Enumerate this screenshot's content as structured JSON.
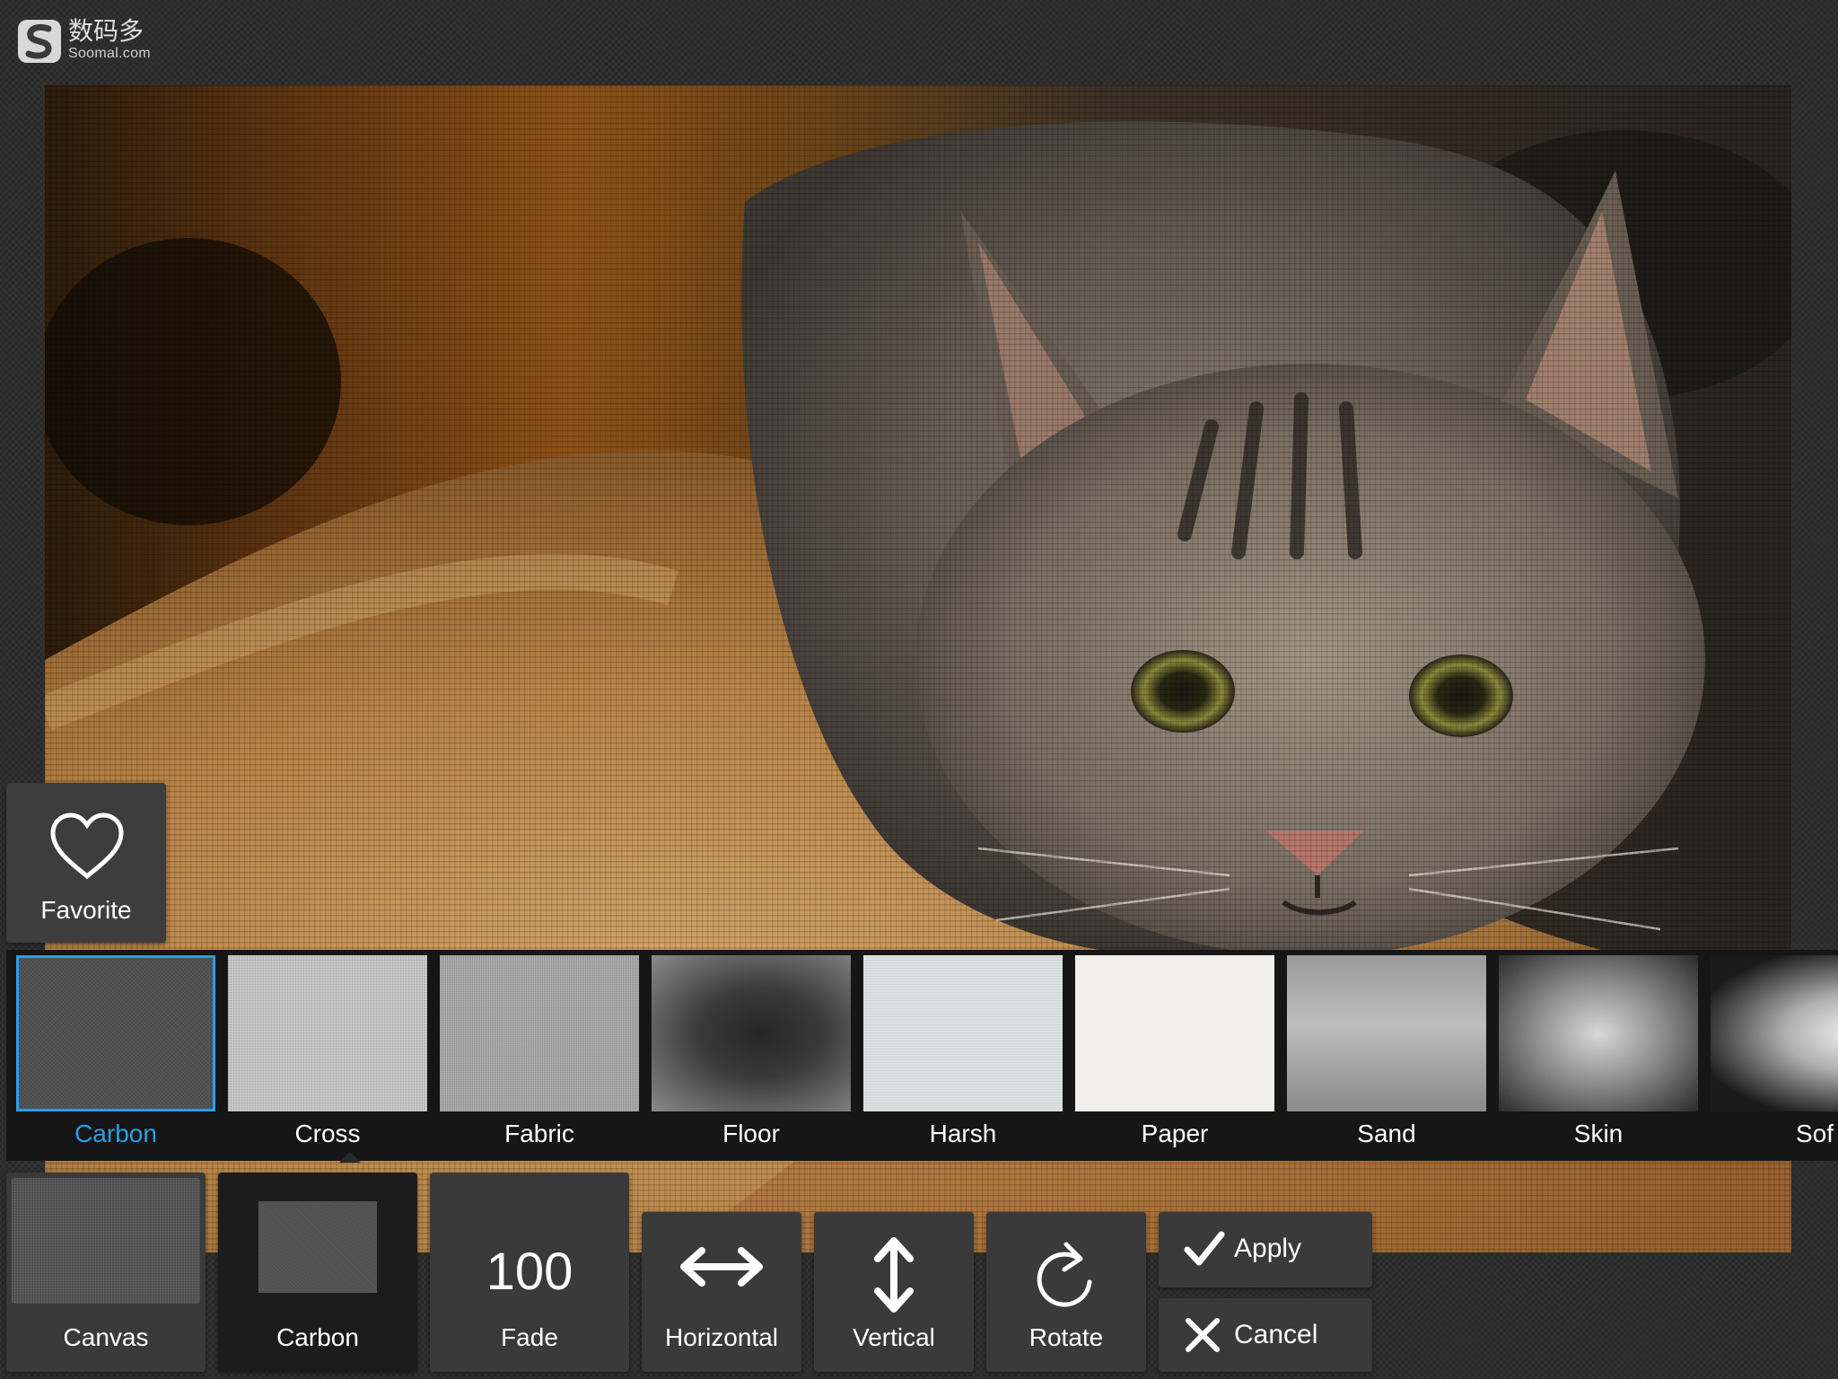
{
  "watermark": {
    "cn": "数码多",
    "en": "Soomal.com"
  },
  "favorite": {
    "label": "Favorite",
    "icon": "heart-icon"
  },
  "textures": [
    {
      "label": "Carbon",
      "selected": true
    },
    {
      "label": "Cross",
      "selected": false
    },
    {
      "label": "Fabric",
      "selected": false
    },
    {
      "label": "Floor",
      "selected": false
    },
    {
      "label": "Harsh",
      "selected": false
    },
    {
      "label": "Paper",
      "selected": false
    },
    {
      "label": "Sand",
      "selected": false
    },
    {
      "label": "Skin",
      "selected": false
    },
    {
      "label": "Sof",
      "selected": false
    }
  ],
  "toolbar": {
    "canvas_label": "Canvas",
    "carbon_label": "Carbon",
    "fade_value": "100",
    "fade_label": "Fade",
    "horizontal_label": "Horizontal",
    "vertical_label": "Vertical",
    "rotate_label": "Rotate",
    "apply_label": "Apply",
    "cancel_label": "Cancel"
  },
  "colors": {
    "accent": "#2a9fe4",
    "panel": "#3a3a3a",
    "strip": "#161616"
  }
}
